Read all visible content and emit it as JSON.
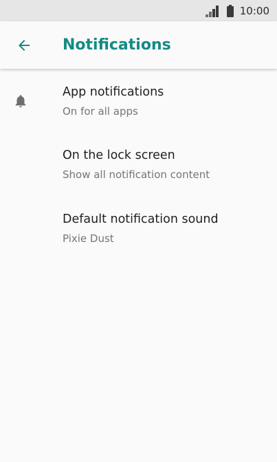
{
  "status_bar": {
    "time": "10:00",
    "icons": [
      "signal-icon",
      "battery-icon"
    ]
  },
  "app_bar": {
    "back_icon": "arrow-left-icon",
    "title": "Notifications"
  },
  "colors": {
    "accent": "#138a85",
    "status_bar_bg": "#e6e6e6",
    "background": "#fafafa",
    "primary_text": "#1f1f1f",
    "secondary_text": "#757575",
    "icon": "#6e6e6e"
  },
  "settings": [
    {
      "icon": "bell-icon",
      "title": "App notifications",
      "summary": "On for all apps"
    },
    {
      "title": "On the lock screen",
      "summary": "Show all notification content"
    },
    {
      "title": "Default notification sound",
      "summary": "Pixie Dust"
    }
  ]
}
